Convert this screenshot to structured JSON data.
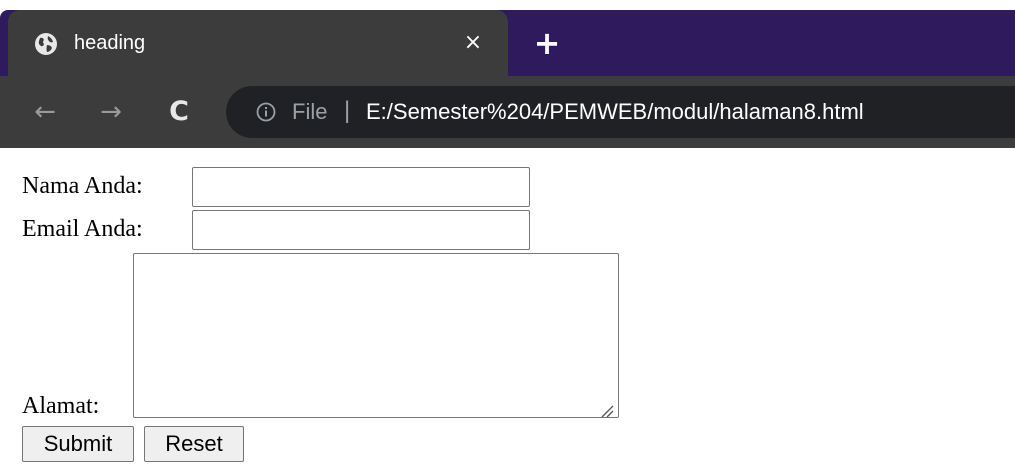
{
  "browser": {
    "tab": {
      "title": "heading",
      "close_glyph": "×",
      "icon": "globe-icon"
    },
    "new_tab_glyph": "+",
    "nav": {
      "back_glyph": "←",
      "forward_glyph": "→",
      "reload_glyph": "C"
    },
    "omnibox": {
      "scheme_label": "File",
      "divider": "|",
      "url": "E:/Semester%204/PEMWEB/modul/halaman8.html",
      "icon": "info-icon"
    },
    "colors": {
      "tabbar": "#2e1a5c",
      "toolbar": "#3c3c3c",
      "omnibox": "#202124"
    }
  },
  "form": {
    "nama_label": "Nama Anda:",
    "nama_value": "",
    "email_label": "Email Anda:",
    "email_value": "",
    "alamat_label": "Alamat:",
    "alamat_value": "",
    "submit_label": "Submit",
    "reset_label": "Reset"
  }
}
